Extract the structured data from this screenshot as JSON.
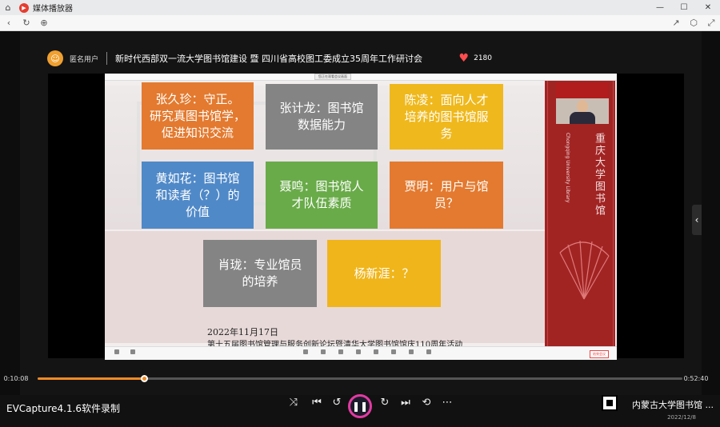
{
  "window": {
    "title": "媒体播放器",
    "brand_color": "#e43d2f"
  },
  "stream": {
    "user": "匿名用户",
    "title": "新时代西部双一流大学图书馆建设 暨 四川省高校图工委成立35周年工作研讨会",
    "likes": "2180"
  },
  "slide": {
    "meeting_tag": "您正在观看会议画面",
    "cards": [
      {
        "text": "张久珍：守正。\n研究真图书馆学，\n促进知识交流",
        "color": "#e37a2f"
      },
      {
        "text": "张计龙：图书馆\n数据能力",
        "color": "#848484"
      },
      {
        "text": "陈凌：面向人才\n培养的图书馆服\n务",
        "color": "#efb81c"
      },
      {
        "text": "黄如花：图书馆\n和读者（？）的\n价值",
        "color": "#5089c8"
      },
      {
        "text": "聂鸣：图书馆人\n才队伍素质",
        "color": "#69ab49"
      },
      {
        "text": "贾明：用户与馆\n员？",
        "color": "#e37a2f"
      },
      {
        "text": "肖珑：专业馆员\n的培养",
        "color": "#848484"
      },
      {
        "text": "杨新涯：？",
        "color": "#f0b51a"
      }
    ],
    "date": "2022年11月17日",
    "caption": "第十五届图书馆管理与服务创新论坛暨清华大学图书馆馆庆110周年活动",
    "library_cn": "重庆大学图书馆",
    "library_en": "Chongqing University Library",
    "end_meeting": "结束会议"
  },
  "player": {
    "current_time": "0:10:08",
    "total_time": "0:52:40",
    "progress": 0.165,
    "accent": "#f08a24"
  },
  "watermark": "EVCapture4.1.6软件录制",
  "tray": {
    "text": "内蒙古大学图书馆 ...",
    "date": "2022/12/8"
  }
}
